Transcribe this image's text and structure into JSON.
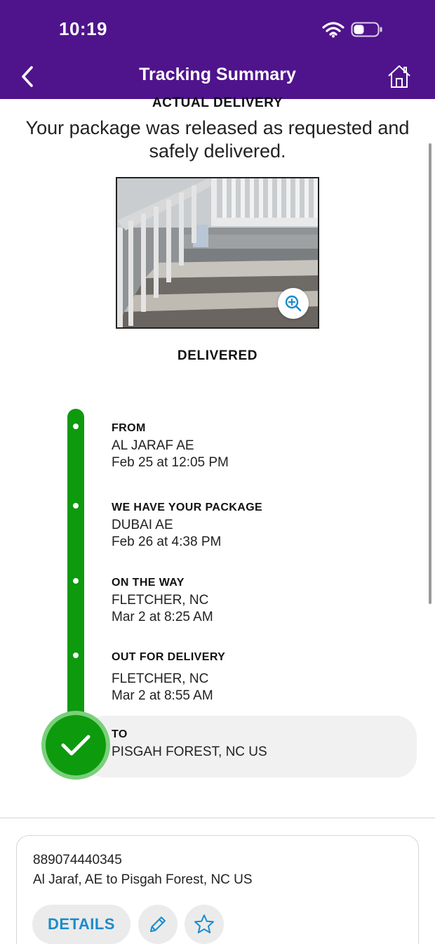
{
  "status_bar": {
    "time": "10:19"
  },
  "header": {
    "title": "Tracking Summary"
  },
  "summary": {
    "section_label": "ACTUAL DELIVERY",
    "message": "Your package was released as requested and safely delivered.",
    "status": "DELIVERED"
  },
  "timeline": [
    {
      "title": "FROM",
      "location": "AL JARAF AE",
      "time": "Feb 25 at 12:05 PM"
    },
    {
      "title": "WE HAVE YOUR PACKAGE",
      "location": "DUBAI AE",
      "time": "Feb 26 at 4:38 PM"
    },
    {
      "title": "ON THE WAY",
      "location": "FLETCHER, NC",
      "time": "Mar 2 at 8:25 AM"
    },
    {
      "title": "OUT FOR DELIVERY",
      "location": "FLETCHER, NC",
      "time": "Mar 2 at 8:55 AM"
    },
    {
      "title": "TO",
      "location": "PISGAH FOREST, NC  US"
    }
  ],
  "card": {
    "tracking_number": "889074440345",
    "route": "Al Jaraf, AE to Pisgah Forest, NC US",
    "details_label": "DETAILS"
  },
  "icons": {
    "back": "chevron-left-icon",
    "home": "home-icon",
    "zoom": "zoom-in-icon",
    "check": "checkmark-icon",
    "edit": "pencil-icon",
    "favorite": "star-icon"
  },
  "colors": {
    "header": "#4f148c",
    "timeline": "#0d9a0d",
    "accent": "#1a8ccd"
  }
}
